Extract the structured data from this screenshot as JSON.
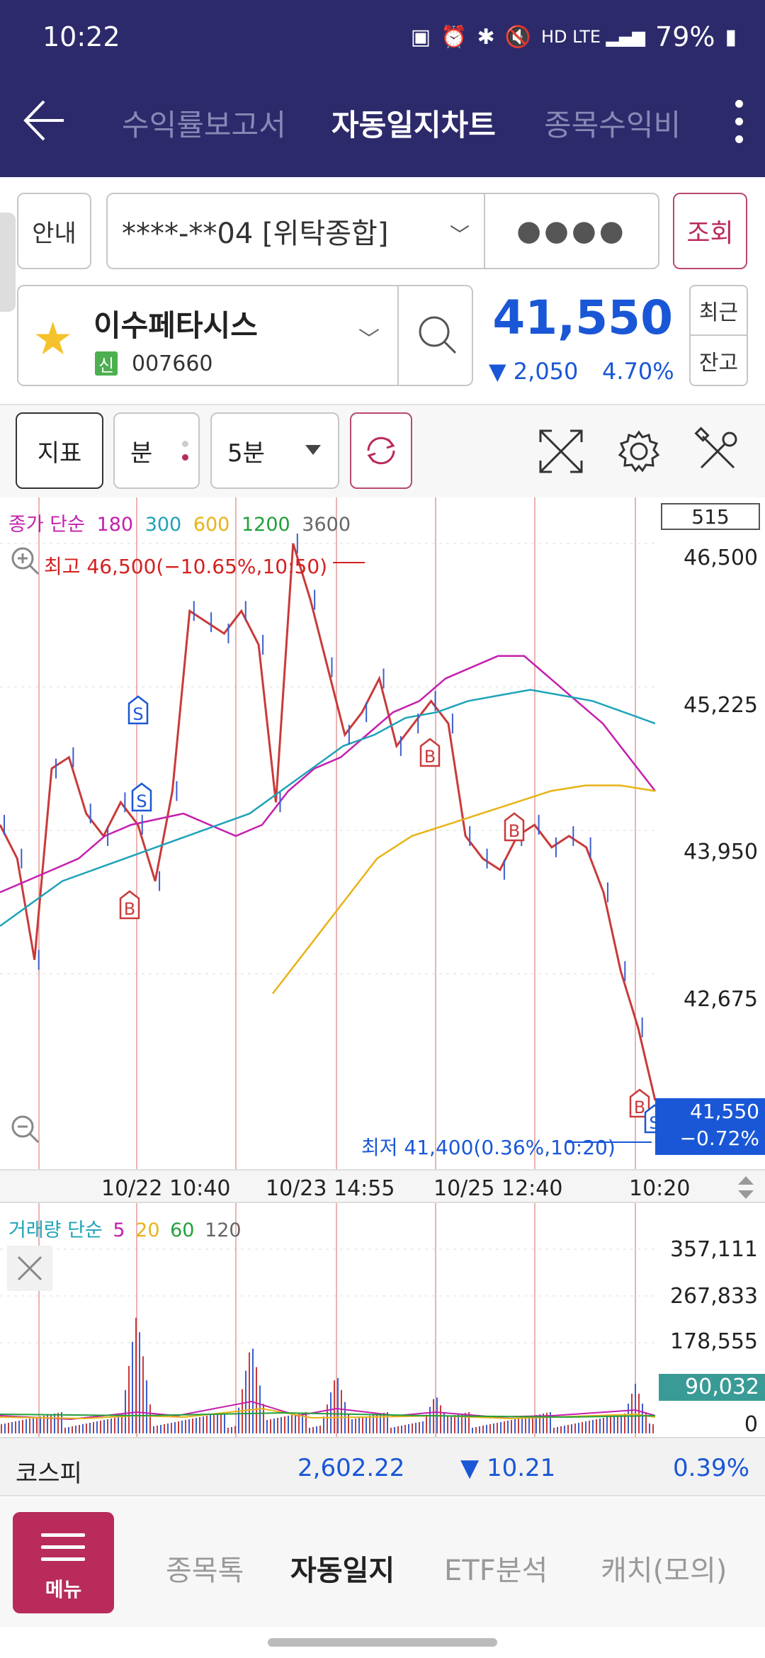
{
  "status": {
    "time": "10:22",
    "battery": "79%",
    "icons": [
      "battery-saver-icon",
      "alarm-icon",
      "bluetooth-icon",
      "mute-icon",
      "hd-voice-icon",
      "lte-icon",
      "signal-icon",
      "battery-icon"
    ]
  },
  "header": {
    "tabs": [
      "수익률보고서",
      "자동일지차트",
      "종목수익비"
    ],
    "active_tab": "자동일지차트"
  },
  "account": {
    "info_label": "안내",
    "account_no": "****-**04 [위탁종합]",
    "password_mask": "●●●●",
    "query_label": "조회"
  },
  "stock": {
    "name": "이수페타시스",
    "badge": "신",
    "code": "007660",
    "price": "41,550",
    "change": "▼ 2,050",
    "change_pct": "4.70%",
    "recent_label": "최근",
    "balance_label": "잔고"
  },
  "toolbar": {
    "indicator_label": "지표",
    "period_label": "분",
    "interval_value": "5분"
  },
  "chart": {
    "legend_prefix": "종가 단순",
    "ma": [
      "180",
      "300",
      "600",
      "1200",
      "3600"
    ],
    "ma_colors": [
      "#c41fae",
      "#1ea3b8",
      "#e8b317",
      "#22a03a",
      "#666666"
    ],
    "count": "515",
    "y_ticks": [
      "46,500",
      "45,225",
      "43,950",
      "42,675"
    ],
    "high_label": "최고 46,500(−10.65%,10:50)",
    "low_label": "최저 41,400(0.36%,10:20)",
    "last_price": "41,550",
    "last_pct": "−0.72%",
    "x_ticks": [
      "10/22 10:40",
      "10/23 14:55",
      "10/25 12:40",
      "10:20"
    ],
    "signals": [
      "S",
      "S",
      "B",
      "B",
      "B",
      "B",
      "S"
    ]
  },
  "chart_data": {
    "type": "line",
    "ylim": [
      41400,
      46500
    ],
    "y_ticks": [
      46500,
      45225,
      43950,
      42675
    ],
    "x_ticks": [
      "10/22 10:40",
      "10/23 14:55",
      "10/25 12:40",
      "10:20"
    ],
    "series": [
      {
        "name": "종가",
        "values": [
          44000,
          43700,
          42800,
          44500,
          44600,
          44100,
          43900,
          44200,
          44000,
          43500,
          44300,
          45900,
          45800,
          45700,
          45900,
          45600,
          44200,
          46500,
          46000,
          45400,
          44800,
          45000,
          45300,
          44700,
          44900,
          45100,
          44900,
          43900,
          43700,
          43600,
          43900,
          44000,
          43800,
          43900,
          43800,
          43400,
          42700,
          42200,
          41550
        ]
      },
      {
        "name": "180",
        "values": [
          43400,
          43500,
          43600,
          43700,
          43900,
          44000,
          44050,
          44100,
          44000,
          43900,
          44000,
          44300,
          44500,
          44600,
          44800,
          45000,
          45100,
          45300,
          45400,
          45500,
          45500,
          45300,
          45100,
          44900,
          44600,
          44300
        ]
      },
      {
        "name": "300",
        "values": [
          43100,
          43300,
          43500,
          43600,
          43700,
          43800,
          43900,
          44000,
          44100,
          44300,
          44500,
          44700,
          44800,
          44950,
          45000,
          45100,
          45150,
          45200,
          45150,
          45100,
          45000,
          44900
        ]
      },
      {
        "name": "600",
        "values": [
          42500,
          42900,
          43300,
          43700,
          43900,
          44000,
          44100,
          44200,
          44300,
          44350,
          44350,
          44300
        ]
      }
    ]
  },
  "volume": {
    "legend_prefix": "거래량 단순",
    "ma": [
      "5",
      "20",
      "60",
      "120"
    ],
    "ma_colors": [
      "#c41fae",
      "#e8b317",
      "#22a03a",
      "#666666"
    ],
    "y_ticks": [
      "357,111",
      "267,833",
      "178,555",
      "0"
    ],
    "last_volume": "90,032"
  },
  "kospi": {
    "name": "코스피",
    "value": "2,602.22",
    "change": "▼ 10.21",
    "pct": "0.39%"
  },
  "bottom_nav": {
    "menu_label": "메뉴",
    "items": [
      "종목톡",
      "자동일지",
      "ETF분석",
      "캐치(모의)"
    ]
  }
}
